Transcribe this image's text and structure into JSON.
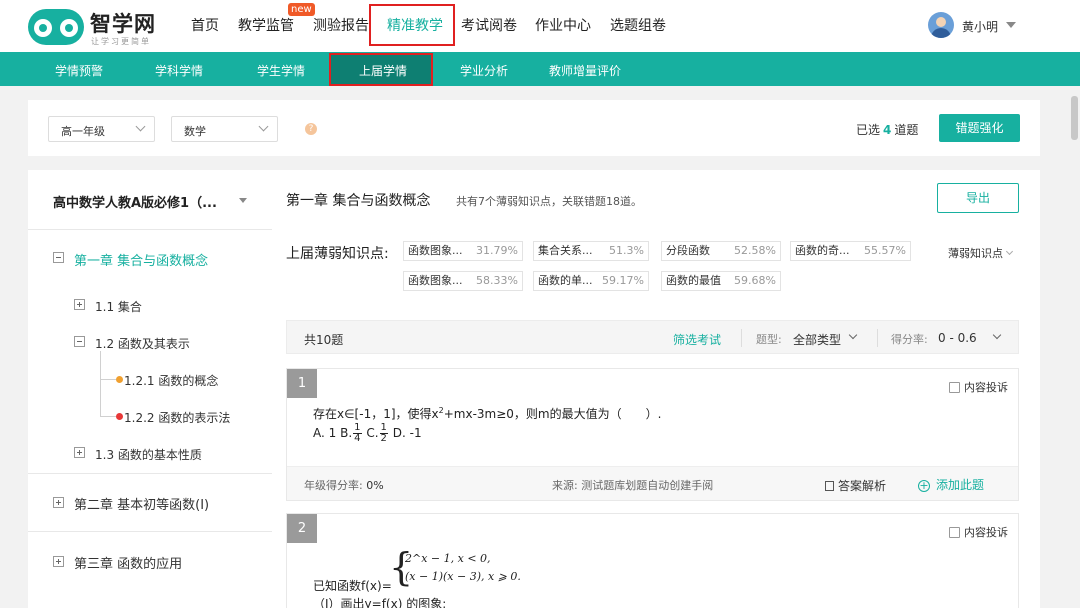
{
  "app": {
    "brand": "智学网",
    "slogan": "让学习更简单"
  },
  "nav": {
    "items": [
      "首页",
      "教学监管",
      "测验报告",
      "精准教学",
      "考试阅卷",
      "作业中心",
      "选题组卷"
    ],
    "badge_new": "new",
    "active": "精准教学"
  },
  "user": {
    "name": "黄小明"
  },
  "subnav": {
    "items": [
      "学情预警",
      "学科学情",
      "学生学情",
      "上届学情",
      "学业分析",
      "教师增量评价"
    ],
    "active": "上届学情"
  },
  "filters": {
    "grade": "高一年级",
    "subject": "数学",
    "help": "?",
    "selected_prefix": "已选",
    "selected_count": "4",
    "selected_suffix": "道题",
    "action": "错题强化"
  },
  "sidebar": {
    "book": "高中数学人教A版必修1（...",
    "tree": {
      "ch1": "第一章 集合与函数概念",
      "s11": "1.1 集合",
      "s12": "1.2 函数及其表示",
      "s121": "1.2.1 函数的概念",
      "s122": "1.2.2 函数的表示法",
      "s13": "1.3 函数的基本性质",
      "ch2": "第二章 基本初等函数(Ⅰ)",
      "ch3": "第三章 函数的应用"
    }
  },
  "main": {
    "chapter_title": "第一章 集合与函数概念",
    "chapter_desc": "共有7个薄弱知识点，关联错题18道。",
    "export": "导出",
    "weak_label": "上届薄弱知识点:",
    "weak_more": "薄弱知识点",
    "weak_points": [
      {
        "name": "函数图象...",
        "pct": "31.79%"
      },
      {
        "name": "集合关系...",
        "pct": "51.3%"
      },
      {
        "name": "分段函数",
        "pct": "52.58%"
      },
      {
        "name": "函数的奇...",
        "pct": "55.57%"
      },
      {
        "name": "函数图象...",
        "pct": "58.33%"
      },
      {
        "name": "函数的单...",
        "pct": "59.17%"
      },
      {
        "name": "函数的最值",
        "pct": "59.68%"
      }
    ],
    "qbar": {
      "count": "共10题",
      "filter_exam": "筛选考试",
      "type_label": "题型:",
      "type_value": "全部类型",
      "score_label": "得分率:",
      "score_value": "0 - 0.6"
    },
    "questions": [
      {
        "num": "1",
        "report": "内容投诉",
        "stem_a": "存在x∈[-1，1]，使得x",
        "stem_sup": "2",
        "stem_b": "+mx-3m≥0，则m的最大值为（　　）.",
        "opt_a": "A. 1",
        "opt_b_label": "B.",
        "opt_b_num": "1",
        "opt_b_den": "4",
        "opt_c_label": "C.",
        "opt_c_num": "1",
        "opt_c_den": "2",
        "opt_d": "D. -1",
        "foot_rate_label": "年级得分率:",
        "foot_rate": "0%",
        "foot_source_label": "来源:",
        "foot_source": "测试题库划题自动创建手阅",
        "foot_answer": "答案解析",
        "foot_add": "添加此题"
      },
      {
        "num": "2",
        "report": "内容投诉",
        "case1": "2^x − 1, x < 0,",
        "case2": "(x − 1)(x − 3), x ⩾ 0.",
        "stem": "已知函数f(x)=",
        "sub1": "（Ⅰ）画出y=f(x) 的图象;"
      }
    ]
  }
}
